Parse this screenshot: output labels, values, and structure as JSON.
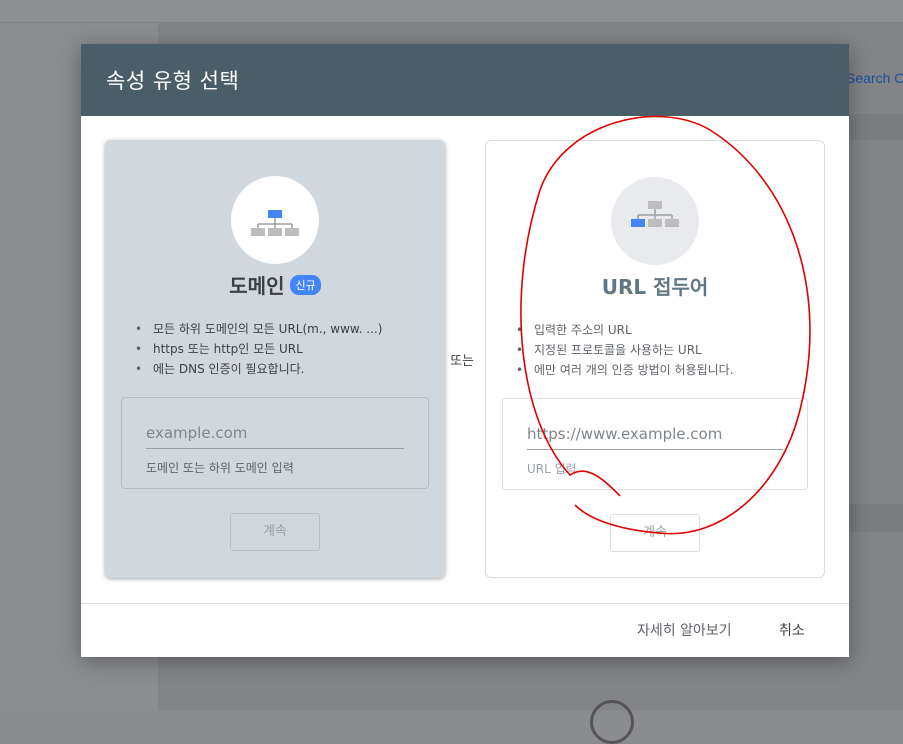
{
  "background": {
    "search_label": "Search C"
  },
  "dialog": {
    "title": "속성 유형 선택",
    "or_label": "또는",
    "domain_card": {
      "title": "도메인",
      "badge": "신규",
      "bullets": [
        "모든 하위 도메인의 모든 URL(m., www. ...)",
        "https 또는 http인 모든 URL",
        "에는 DNS 인증이 필요합니다."
      ],
      "input_placeholder": "example.com",
      "input_hint": "도메인 또는 하위 도메인 입력",
      "continue_label": "계속"
    },
    "url_card": {
      "title": "URL 접두어",
      "bullets": [
        "입력한 주소의 URL",
        "지정된 프로토콜을 사용하는 URL",
        "에만 여러 개의 인증 방법이 허용됩니다."
      ],
      "input_placeholder": "https://www.example.com",
      "input_hint": "URL 입력",
      "continue_label": "계속"
    },
    "footer": {
      "learn_more_label": "자세히 알아보기",
      "cancel_label": "취소"
    }
  },
  "colors": {
    "header": "#4a5e6a",
    "accent": "#4285f4",
    "annotation": "#e00000"
  },
  "icons": {
    "domain_card_icon": "sitemap-icon",
    "url_card_icon": "sitemap-icon"
  }
}
